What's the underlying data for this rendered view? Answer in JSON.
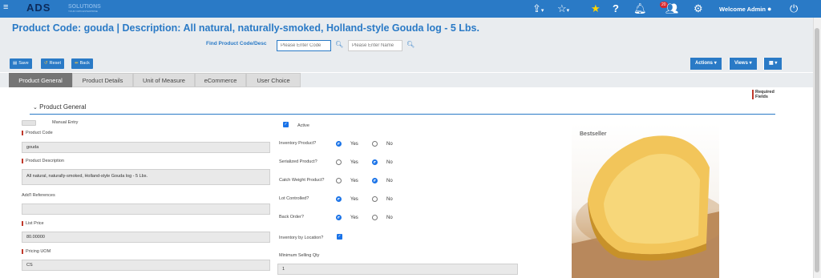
{
  "topbar": {
    "logo_text": "ADS",
    "logo_sub": "SOLUTIONS",
    "logo_tag": "YOUR OWN ENTERPRISE",
    "notification_count": "20",
    "welcome": "Welcome Admin"
  },
  "page": {
    "title": "Product Code: gouda | Description: All natural, naturally-smoked, Holland-style Gouda log - 5 Lbs."
  },
  "find": {
    "label": "Find Product Code/Desc",
    "code_placeholder": "Please Enter Code",
    "name_placeholder": "Please Enter Name"
  },
  "toolbar": {
    "save": "Save",
    "reset": "Reset",
    "back": "Back",
    "actions": "Actions",
    "views": "Views"
  },
  "tabs": [
    {
      "label": "Product General"
    },
    {
      "label": "Product Details"
    },
    {
      "label": "Unit of Measure"
    },
    {
      "label": "eCommerce"
    },
    {
      "label": "User Choice"
    }
  ],
  "form": {
    "required_fields": "Required Fields",
    "section_title": "Product General",
    "manual_entry": "Manual Entry",
    "product_code_label": "Product Code",
    "product_code_value": "gouda",
    "product_description_label": "Product Description",
    "product_description_value": "All natural, naturally-smoked, Holland-style Gouda log - 5 Lbs.",
    "addl_references_label": "Add'l References",
    "addl_references_value": "",
    "list_price_label": "List Price",
    "list_price_value": "80.00000",
    "pricing_uom_label": "Pricing UOM",
    "pricing_uom_value": "CS",
    "active_label": "Active",
    "inventory_product_label": "Inventory Product?",
    "serialized_product_label": "Serialized Product?",
    "catch_weight_label": "Catch Weight Product?",
    "lot_controlled_label": "Lot Controlled?",
    "back_order_label": "Back Order?",
    "inventory_by_location_label": "Inventory by Location?",
    "minimum_selling_qty_label": "Minimum Selling Qty",
    "minimum_selling_qty_value": "1",
    "yes": "Yes",
    "no": "No",
    "image_badge": "Bestseller"
  }
}
